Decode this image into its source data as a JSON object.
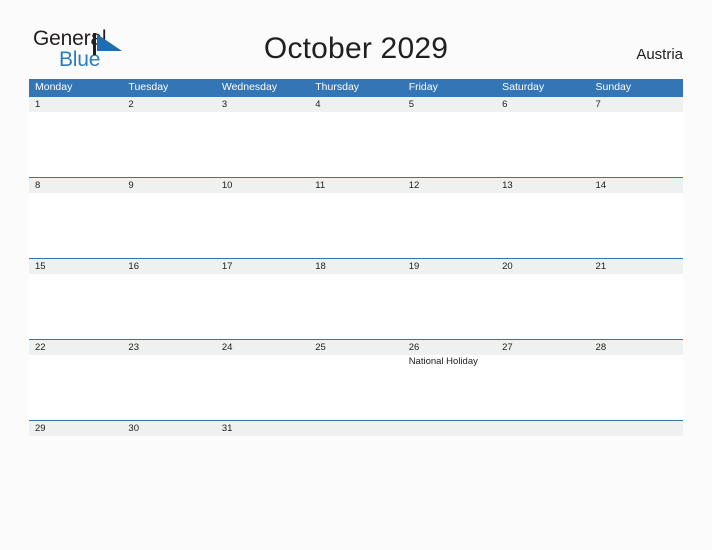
{
  "logo": {
    "line1": "General",
    "line2": "Blue",
    "mark_icon": "triangle-flag-icon",
    "brand_color": "#2b7cc3",
    "text_color": "#231f20"
  },
  "header": {
    "title": "October 2029",
    "country": "Austria"
  },
  "theme": {
    "header_blue": "#3375b5",
    "date_band_gray": "#eff0f0",
    "page_background": "#fbfbfb",
    "text": "#202020"
  },
  "calendar": {
    "month": "October",
    "year": "2029",
    "weekday_headers": [
      "Monday",
      "Tuesday",
      "Wednesday",
      "Thursday",
      "Friday",
      "Saturday",
      "Sunday"
    ],
    "weeks": [
      {
        "days": [
          {
            "num": "1",
            "event": ""
          },
          {
            "num": "2",
            "event": ""
          },
          {
            "num": "3",
            "event": ""
          },
          {
            "num": "4",
            "event": ""
          },
          {
            "num": "5",
            "event": ""
          },
          {
            "num": "6",
            "event": ""
          },
          {
            "num": "7",
            "event": ""
          }
        ]
      },
      {
        "days": [
          {
            "num": "8",
            "event": ""
          },
          {
            "num": "9",
            "event": ""
          },
          {
            "num": "10",
            "event": ""
          },
          {
            "num": "11",
            "event": ""
          },
          {
            "num": "12",
            "event": ""
          },
          {
            "num": "13",
            "event": ""
          },
          {
            "num": "14",
            "event": ""
          }
        ]
      },
      {
        "days": [
          {
            "num": "15",
            "event": ""
          },
          {
            "num": "16",
            "event": ""
          },
          {
            "num": "17",
            "event": ""
          },
          {
            "num": "18",
            "event": ""
          },
          {
            "num": "19",
            "event": ""
          },
          {
            "num": "20",
            "event": ""
          },
          {
            "num": "21",
            "event": ""
          }
        ]
      },
      {
        "days": [
          {
            "num": "22",
            "event": ""
          },
          {
            "num": "23",
            "event": ""
          },
          {
            "num": "24",
            "event": ""
          },
          {
            "num": "25",
            "event": ""
          },
          {
            "num": "26",
            "event": "National Holiday"
          },
          {
            "num": "27",
            "event": ""
          },
          {
            "num": "28",
            "event": ""
          }
        ]
      },
      {
        "days": [
          {
            "num": "29",
            "event": ""
          },
          {
            "num": "30",
            "event": ""
          },
          {
            "num": "31",
            "event": ""
          },
          {
            "num": "",
            "event": ""
          },
          {
            "num": "",
            "event": ""
          },
          {
            "num": "",
            "event": ""
          },
          {
            "num": "",
            "event": ""
          }
        ]
      }
    ]
  }
}
